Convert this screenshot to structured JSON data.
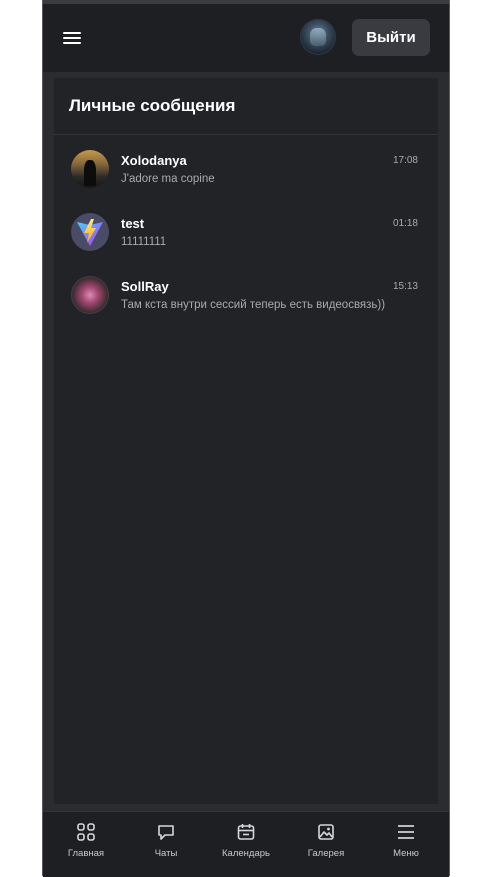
{
  "header": {
    "logout_label": "Выйти"
  },
  "panel": {
    "title": "Личные сообщения"
  },
  "chats": [
    {
      "name": "Xolodanya",
      "message": "J'adore ma copine",
      "time": "17:08"
    },
    {
      "name": "test",
      "message": "11111111",
      "time": "01:18"
    },
    {
      "name": "SollRay",
      "message": "Там кста внутри сессий теперь есть видеосвязь))",
      "time": "15:13"
    }
  ],
  "nav": {
    "items": [
      {
        "label": "Главная",
        "icon": "grid-icon"
      },
      {
        "label": "Чаты",
        "icon": "chat-icon"
      },
      {
        "label": "Календарь",
        "icon": "calendar-icon"
      },
      {
        "label": "Галерея",
        "icon": "gallery-icon"
      },
      {
        "label": "Меню",
        "icon": "menu-icon"
      }
    ]
  },
  "colors": {
    "background": "#2b2c30",
    "topbar": "#1e1f22",
    "panel": "#222327",
    "button": "#3a3b40",
    "text": "#ffffff",
    "muted": "#a9aaae"
  }
}
